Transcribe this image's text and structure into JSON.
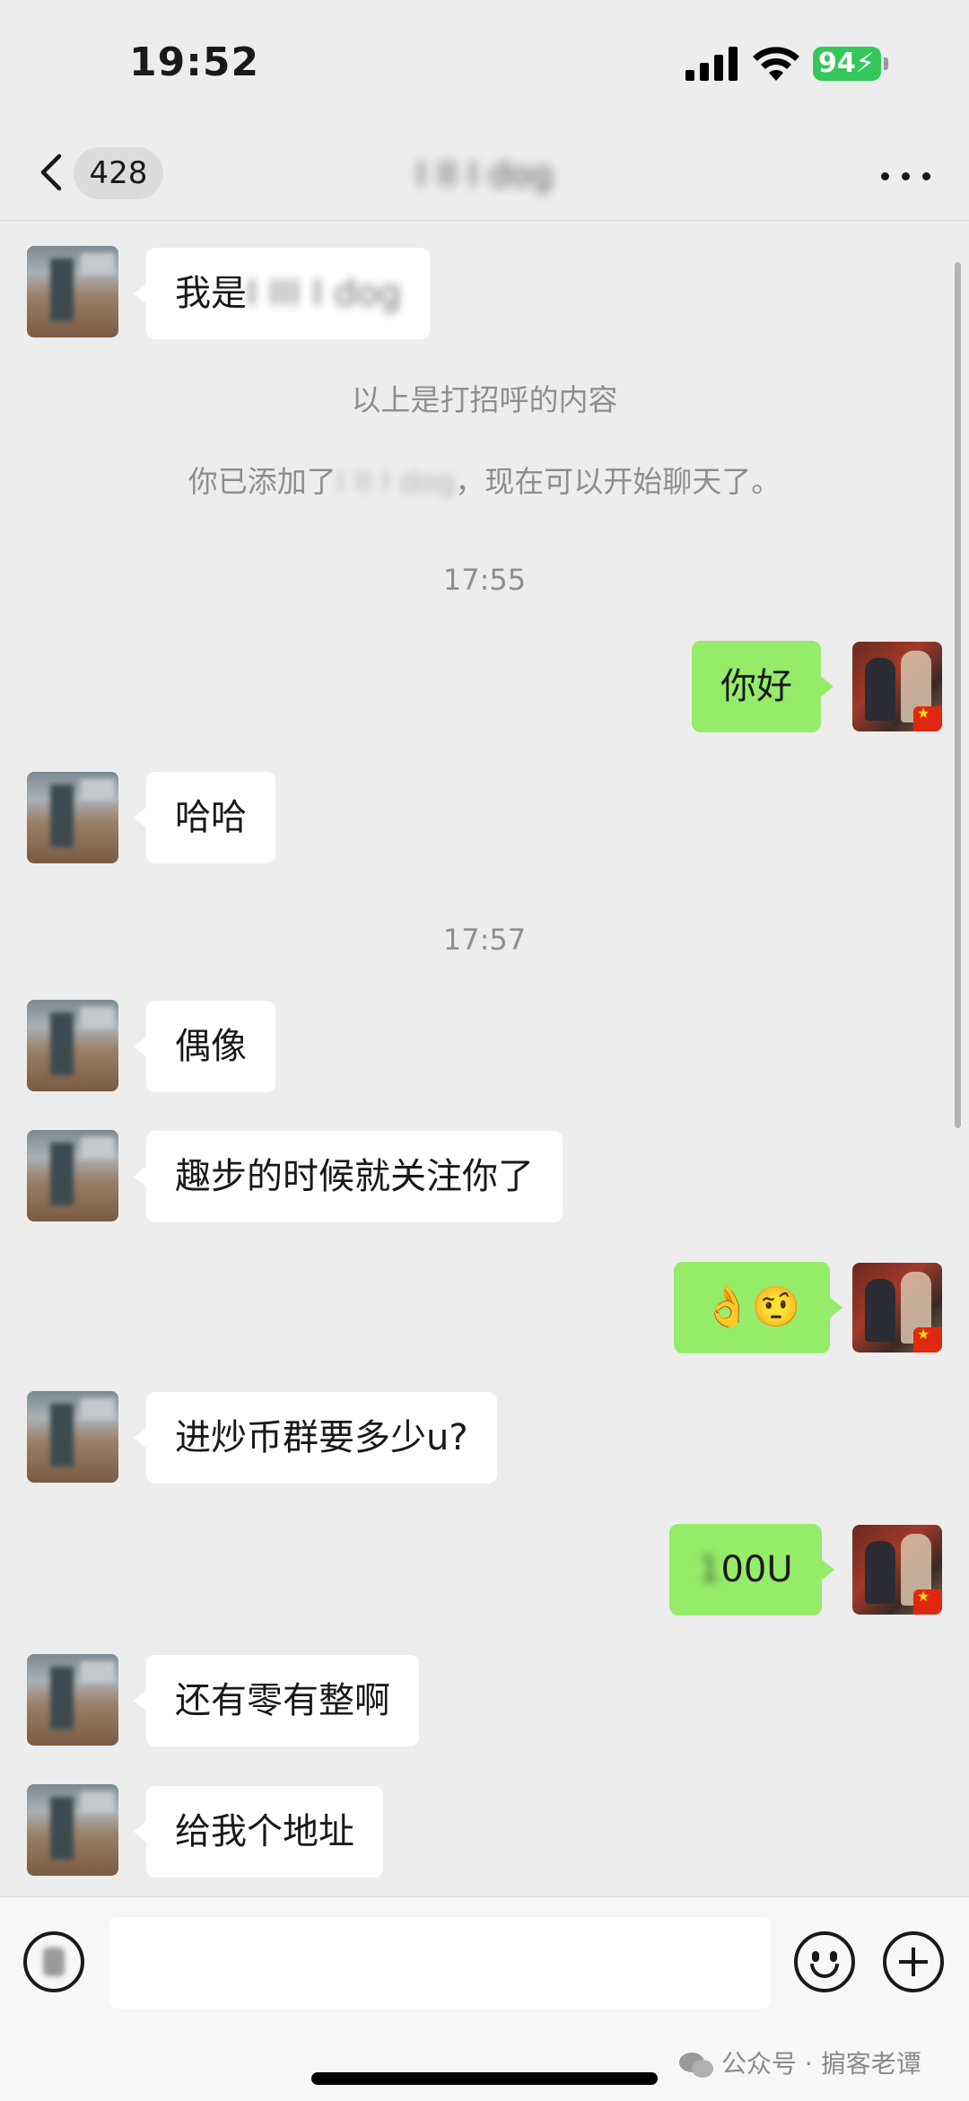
{
  "status_bar": {
    "time": "19:52",
    "battery": "94"
  },
  "nav": {
    "unread_count": "428",
    "title": "I II I dog"
  },
  "messages": {
    "m1": {
      "prefix": "我是",
      "blurred": "I III I dog"
    },
    "sys_greeting": "以上是打招呼的内容",
    "sys_added": {
      "before": "你已添加了",
      "blurred": "I II I dog",
      "after": "，现在可以开始聊天了。"
    },
    "time1": "17:55",
    "m2": "你好",
    "m3": "哈哈",
    "time2": "17:57",
    "m4": "偶像",
    "m5": "趣步的时候就关注你了",
    "m6": "👌🤨",
    "m7": "进炒币群要多少u?",
    "m8": {
      "blurred": "1",
      "suffix": "00U"
    },
    "m9": "还有零有整啊",
    "m10": "给我个地址"
  },
  "input": {
    "placeholder": ""
  },
  "watermark": "公众号 · 掮客老谭",
  "colors": {
    "outgoing_bubble": "#95ec69",
    "incoming_bubble": "#ffffff",
    "background": "#ededed",
    "badge": "#34c759"
  },
  "icons": [
    "back-chevron-icon",
    "more-icon",
    "voice-icon",
    "emoji-icon",
    "plus-icon",
    "signal-icon",
    "wifi-icon",
    "battery-icon",
    "wechat-icon"
  ]
}
